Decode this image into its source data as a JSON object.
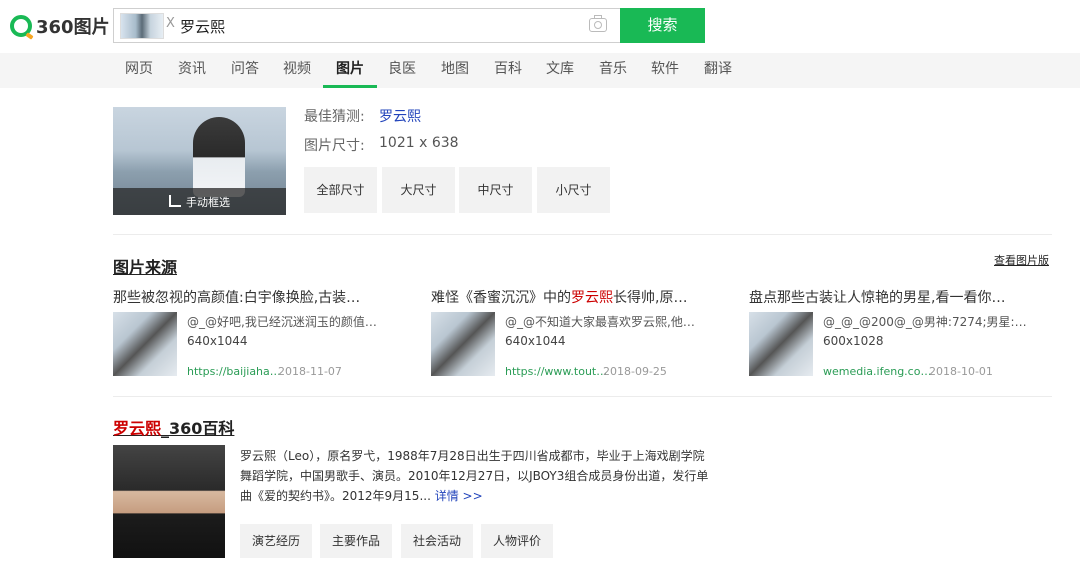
{
  "header": {
    "logo_text": "360图片",
    "close_mark": "X",
    "query": "罗云熙",
    "search_label": "搜索"
  },
  "nav": {
    "items": [
      "网页",
      "资讯",
      "问答",
      "视频",
      "图片",
      "良医",
      "地图",
      "百科",
      "文库",
      "音乐",
      "软件",
      "翻译"
    ],
    "active": "图片"
  },
  "result": {
    "crop_label": "手动框选",
    "guess_label": "最佳猜测:",
    "guess_value": "罗云熙",
    "size_label": "图片尺寸:",
    "size_value": "1021 x 638",
    "size_filters": [
      "全部尺寸",
      "大尺寸",
      "中尺寸",
      "小尺寸"
    ]
  },
  "sources": {
    "title": "图片来源",
    "view_link": "查看图片版",
    "items": [
      {
        "title": "那些被忽视的高颜值:白宇像换脸,古装…",
        "desc": "@_@好吧,我已经沉迷润玉的颜值…",
        "size": "640x1044",
        "url": "https://baijiaha…",
        "date": "2018-11-07"
      },
      {
        "title_pre": "难怪《香蜜沉沉》中的",
        "title_hl": "罗云熙",
        "title_post": "长得帅,原…",
        "desc": "@_@不知道大家最喜欢罗云熙,他…",
        "size": "640x1044",
        "url": "https://www.tout…",
        "date": "2018-09-25"
      },
      {
        "title": "盘点那些古装让人惊艳的男星,看一看你…",
        "desc": "@_@_@200@_@男神:7274;男星:…",
        "size": "600x1028",
        "url": "wemedia.ifeng.co…",
        "date": "2018-10-01"
      }
    ]
  },
  "baike": {
    "title_hl": "罗云熙",
    "title_rest": "_360百科",
    "text": "罗云熙（Leo），原名罗弋，1988年7月28日出生于四川省成都市，毕业于上海戏剧学院舞蹈学院，中国男歌手、演员。2010年12月27日，以JBOY3组合成员身份出道，发行单曲《爱的契约书》。2012年9月15...",
    "more": "详情 >>",
    "buttons": [
      "演艺经历",
      "主要作品",
      "社会活动",
      "人物评价"
    ]
  },
  "colors": {
    "brand_green": "#19b955",
    "highlight_red": "#cc0000",
    "link_blue": "#2244bb",
    "url_green": "#2a9c55"
  }
}
